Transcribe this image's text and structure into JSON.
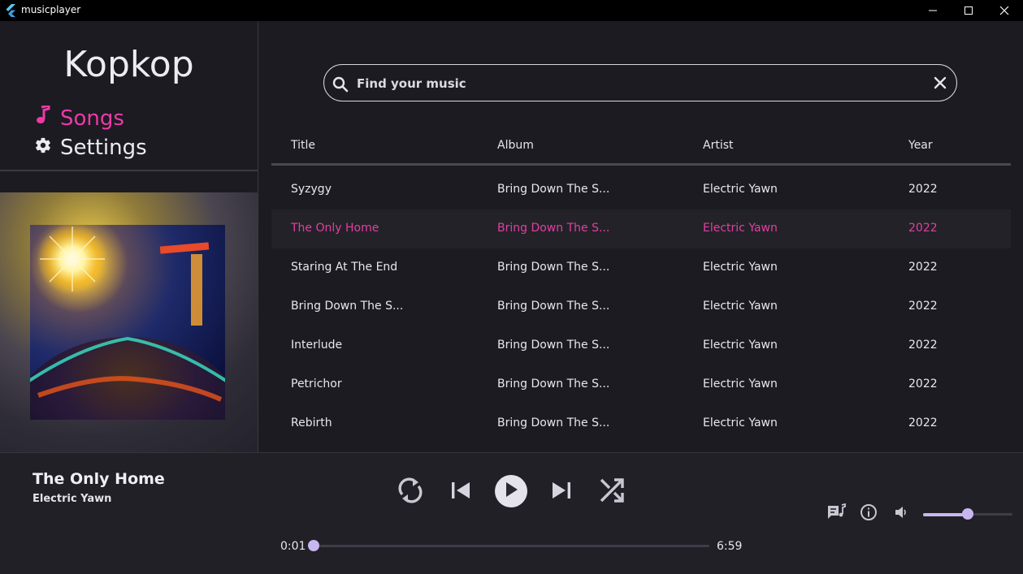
{
  "window": {
    "title": "musicplayer"
  },
  "sidebar": {
    "logo": "Kopkop",
    "nav": [
      {
        "label": "Songs",
        "icon": "music-note-icon",
        "active": true
      },
      {
        "label": "Settings",
        "icon": "gear-icon",
        "active": false
      }
    ]
  },
  "search": {
    "placeholder": "Find your music",
    "value": ""
  },
  "table": {
    "headers": [
      "Title",
      "Album",
      "Artist",
      "Year"
    ],
    "rows": [
      {
        "title": "Syzygy",
        "album": "Bring Down The S...",
        "artist": "Electric Yawn",
        "year": "2022"
      },
      {
        "title": "The Only Home",
        "album": "Bring Down The S...",
        "artist": "Electric Yawn",
        "year": "2022"
      },
      {
        "title": "Staring At The End",
        "album": "Bring Down The S...",
        "artist": "Electric Yawn",
        "year": "2022"
      },
      {
        "title": "Bring Down The S...",
        "album": "Bring Down The S...",
        "artist": "Electric Yawn",
        "year": "2022"
      },
      {
        "title": "Interlude",
        "album": "Bring Down The S...",
        "artist": "Electric Yawn",
        "year": "2022"
      },
      {
        "title": "Petrichor",
        "album": "Bring Down The S...",
        "artist": "Electric Yawn",
        "year": "2022"
      },
      {
        "title": "Rebirth",
        "album": "Bring Down The S...",
        "artist": "Electric Yawn",
        "year": "2022"
      }
    ],
    "active_row": 1
  },
  "player": {
    "title": "The Only Home",
    "artist": "Electric Yawn",
    "elapsed": "0:01",
    "duration": "6:59",
    "progress": 0.0024,
    "volume": 0.5
  },
  "colors": {
    "accent": "#e33fa0",
    "slider": "#c8b6f0",
    "background": "#1c1b22"
  }
}
